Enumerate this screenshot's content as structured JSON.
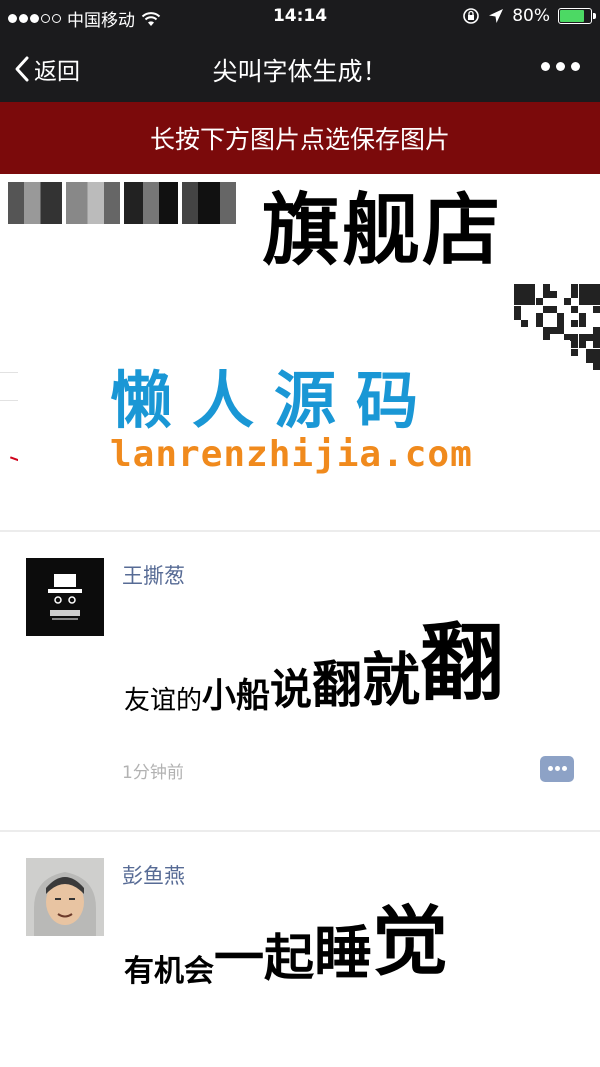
{
  "status_bar": {
    "carrier": "中国移动",
    "time": "14:14",
    "battery": "80%",
    "battery_level": 0.8
  },
  "nav": {
    "back_label": "返回",
    "title": "尖叫字体生成！"
  },
  "banner": {
    "text": "长按下方图片点选保存图片"
  },
  "image": {
    "store_text": "旗舰店",
    "watermark_title": "懒人源码",
    "watermark_url": "lanrenzhijia.com"
  },
  "posts": [
    {
      "name": "王撕葱",
      "text_parts": [
        "友谊的",
        "小船",
        "说",
        "翻",
        "就",
        "翻"
      ],
      "time": "1分钟前"
    },
    {
      "name": "彭鱼燕",
      "text_parts": [
        "有机会",
        "一起",
        "睡",
        "觉"
      ]
    }
  ],
  "colors": {
    "nav_bg": "#1b1b1d",
    "banner_bg": "#7b0a0b",
    "name_color": "#576b95",
    "watermark_blue": "#1a97d5",
    "watermark_orange": "#f08a1d",
    "battery_green": "#4cd964"
  },
  "icons": {
    "back": "chevron-left-icon",
    "more": "more-dots-icon",
    "wifi": "wifi-icon",
    "location": "location-arrow-icon",
    "lock": "orientation-lock-icon",
    "comment": "comment-icon"
  }
}
